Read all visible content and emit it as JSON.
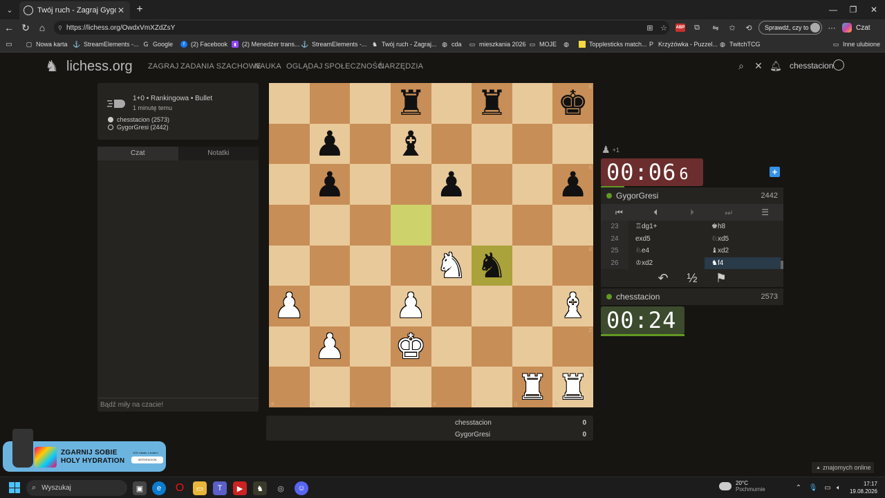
{
  "browser": {
    "tab_title": "Twój ruch - Zagraj GygorGresi",
    "url": "https://lichess.org/OwdxVmXZdZsY",
    "profile_button": "Sprawdź, czy to Ty",
    "copilot_label": "Czat",
    "bookmarks": [
      {
        "label": "Nowa karta",
        "icon": "new-tab-icon"
      },
      {
        "label": "StreamElements -...",
        "icon": "streamelements-icon"
      },
      {
        "label": "Google",
        "icon": "google-icon"
      },
      {
        "label": "(2) Facebook",
        "icon": "facebook-icon"
      },
      {
        "label": "(2) Menedżer trans...",
        "icon": "twitch-icon"
      },
      {
        "label": "StreamElements -...",
        "icon": "streamelements-icon"
      },
      {
        "label": "Twój ruch - Zagraj...",
        "icon": "lichess-icon"
      },
      {
        "label": "cda",
        "icon": "globe-icon"
      },
      {
        "label": "mieszkania 2026",
        "icon": "folder-icon"
      },
      {
        "label": "MOJE",
        "icon": "folder-icon"
      },
      {
        "label": "",
        "icon": "globe-icon"
      },
      {
        "label": "Topplesticks match...",
        "icon": "sticky-icon"
      },
      {
        "label": "Krzyżówka - Puzzel...",
        "icon": "puzzle-icon"
      },
      {
        "label": "TwitchTCG",
        "icon": "globe-icon"
      }
    ],
    "other_bookmarks": "Inne ulubione"
  },
  "site": {
    "logo": "lichess.org",
    "menu": [
      "ZAGRAJ",
      "ZADANIA SZACHOWE",
      "NAUKA",
      "OGLĄDAJ",
      "SPOŁECZNOŚĆ",
      "NARZĘDZIA"
    ],
    "username": "chesstacion"
  },
  "game_meta": {
    "setup": "1+0 • Rankingowa • Bullet",
    "ago": "1 minutę temu",
    "white_player": "chesstacion (2573)",
    "black_player": "GygorGresi (2442)"
  },
  "chat": {
    "tab_chat": "Czat",
    "tab_notes": "Notatki",
    "placeholder": "Bądź miły na czacie!"
  },
  "promo": {
    "line1": "ZGARNIJ SOBIE",
    "line2": "HOLY HYDRATION",
    "small": "10% rabatu z kodem",
    "badge": "INTENTACION"
  },
  "board": {
    "position": [
      [
        "",
        "",
        "",
        "bR",
        "",
        "bR",
        "",
        "bK"
      ],
      [
        "",
        "bP",
        "",
        "bB",
        "",
        "",
        "",
        ""
      ],
      [
        "",
        "bP",
        "",
        "",
        "bP",
        "",
        "",
        "bP"
      ],
      [
        "",
        "",
        "",
        "",
        "",
        "",
        "",
        ""
      ],
      [
        "",
        "",
        "",
        "",
        "wN",
        "bN",
        "",
        ""
      ],
      [
        "wP",
        "",
        "",
        "wP",
        "",
        "",
        "",
        "wB"
      ],
      [
        "",
        "wP",
        "",
        "wK",
        "",
        "",
        "",
        ""
      ],
      [
        "",
        "",
        "",
        "",
        "",
        "",
        "wR",
        "wR"
      ]
    ],
    "highlight_squares": [
      "d5",
      "f4"
    ],
    "files": [
      "a",
      "b",
      "c",
      "d",
      "e",
      "f",
      "g",
      "h"
    ],
    "ranks": [
      "8",
      "7",
      "6",
      "5",
      "4",
      "3",
      "2",
      "1"
    ]
  },
  "score": {
    "rows": [
      {
        "name": "chesstacion",
        "value": "0"
      },
      {
        "name": "GygorGresi",
        "value": "0"
      }
    ]
  },
  "opponent": {
    "material": "+1",
    "clock_main": "00:06",
    "clock_tenth": "6",
    "name": "GygorGresi",
    "rating": "2442"
  },
  "player": {
    "clock_main": "00:24",
    "name": "chesstacion",
    "rating": "2573"
  },
  "moves": [
    {
      "num": "23",
      "white": "♖dg1+",
      "black": "♚h8"
    },
    {
      "num": "24",
      "white": "exd5",
      "black": "♘xd5"
    },
    {
      "num": "25",
      "white": "♘e4",
      "black": "♝xd2"
    },
    {
      "num": "26",
      "white": "♔xd2",
      "black": "♞f4"
    }
  ],
  "current_move": "26b",
  "taskbar": {
    "search": "Wyszukaj",
    "weather_temp": "20°C",
    "weather_desc": "Pochmurnie",
    "time": "17:17",
    "date": "19.08.2026"
  },
  "friends": "znajomych online"
}
